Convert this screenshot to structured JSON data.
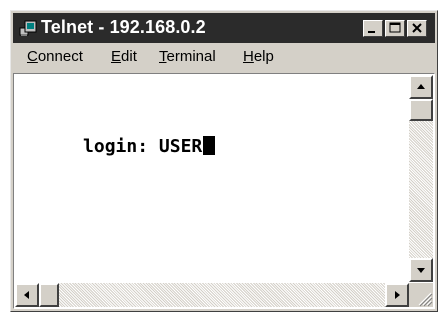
{
  "window": {
    "title": "Telnet - 192.168.0.2"
  },
  "menu": {
    "items": [
      {
        "hotkey": "C",
        "rest": "onnect"
      },
      {
        "hotkey": "E",
        "rest": "dit"
      },
      {
        "hotkey": "T",
        "rest": "erminal"
      },
      {
        "hotkey": "H",
        "rest": "elp"
      }
    ]
  },
  "terminal": {
    "line1": "login: USER"
  },
  "icons": {
    "app": "telnet-terminal-icon",
    "minimize": "minimize-icon",
    "maximize": "maximize-icon",
    "close": "close-icon",
    "scroll_up": "arrow-up-icon",
    "scroll_down": "arrow-down-icon",
    "scroll_left": "arrow-left-icon",
    "scroll_right": "arrow-right-icon",
    "grip": "resize-grip-icon"
  }
}
